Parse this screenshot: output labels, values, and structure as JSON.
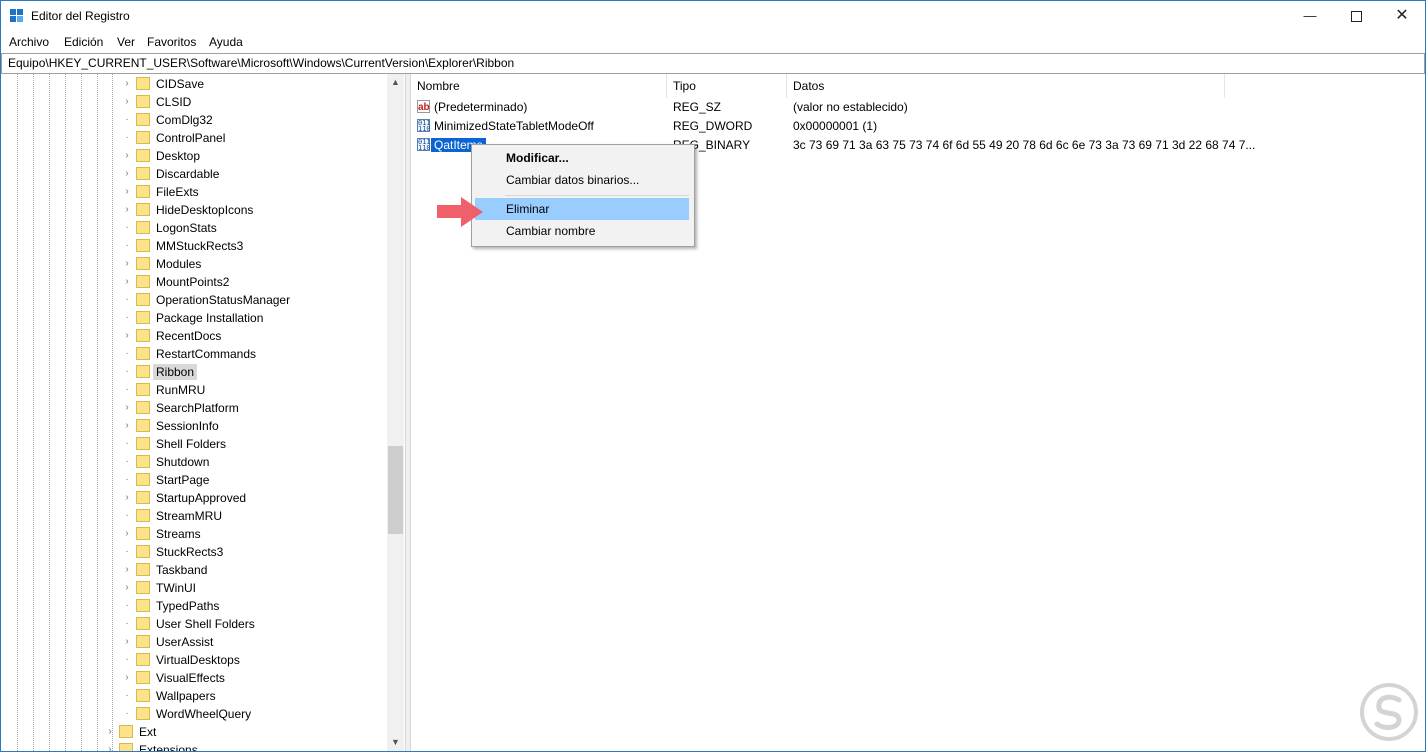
{
  "window": {
    "title": "Editor del Registro"
  },
  "menu": [
    "Archivo",
    "Edición",
    "Ver",
    "Favoritos",
    "Ayuda"
  ],
  "address": {
    "path": "Equipo\\HKEY_CURRENT_USER\\Software\\Microsoft\\Windows\\CurrentVersion\\Explorer\\Ribbon"
  },
  "tree": {
    "items": [
      {
        "label": "CIDSave"
      },
      {
        "label": "CLSID"
      },
      {
        "label": "ComDlg32"
      },
      {
        "label": "ControlPanel"
      },
      {
        "label": "Desktop"
      },
      {
        "label": "Discardable"
      },
      {
        "label": "FileExts"
      },
      {
        "label": "HideDesktopIcons"
      },
      {
        "label": "LogonStats"
      },
      {
        "label": "MMStuckRects3"
      },
      {
        "label": "Modules"
      },
      {
        "label": "MountPoints2"
      },
      {
        "label": "OperationStatusManager"
      },
      {
        "label": "Package Installation"
      },
      {
        "label": "RecentDocs"
      },
      {
        "label": "RestartCommands"
      },
      {
        "label": "Ribbon"
      },
      {
        "label": "RunMRU"
      },
      {
        "label": "SearchPlatform"
      },
      {
        "label": "SessionInfo"
      },
      {
        "label": "Shell Folders"
      },
      {
        "label": "Shutdown"
      },
      {
        "label": "StartPage"
      },
      {
        "label": "StartupApproved"
      },
      {
        "label": "StreamMRU"
      },
      {
        "label": "Streams"
      },
      {
        "label": "StuckRects3"
      },
      {
        "label": "Taskband"
      },
      {
        "label": "TWinUI"
      },
      {
        "label": "TypedPaths"
      },
      {
        "label": "User Shell Folders"
      },
      {
        "label": "UserAssist"
      },
      {
        "label": "VirtualDesktops"
      },
      {
        "label": "VisualEffects"
      },
      {
        "label": "Wallpapers"
      },
      {
        "label": "WordWheelQuery"
      }
    ],
    "parent_items": [
      {
        "label": "Ext"
      },
      {
        "label": "Extensions"
      }
    ],
    "selected": "Ribbon"
  },
  "list": {
    "columns": [
      "Nombre",
      "Tipo",
      "Datos"
    ],
    "rows": [
      {
        "name": "(Predeterminado)",
        "type": "REG_SZ",
        "data": "(valor no establecido)",
        "icon": "string-value-icon"
      },
      {
        "name": "MinimizedStateTabletModeOff",
        "type": "REG_DWORD",
        "data": "0x00000001 (1)",
        "icon": "binary-value-icon"
      },
      {
        "name": "QatItems",
        "type": "REG_BINARY",
        "data": "3c 73 69 71 3a 63 75 73 74 6f 6d 55 49 20 78 6d 6c 6e 73 3a 73 69 71 3d 22 68 74 7...",
        "icon": "binary-value-icon"
      }
    ]
  },
  "context_menu": {
    "items": [
      "Modificar...",
      "Cambiar datos binarios...",
      "Eliminar",
      "Cambiar nombre"
    ],
    "highlighted": "Eliminar"
  },
  "colors": {
    "selection": "#0a64d2",
    "menu_highlight": "#99ccff",
    "arrow": "#f0606a",
    "folder": "#fce38a"
  }
}
